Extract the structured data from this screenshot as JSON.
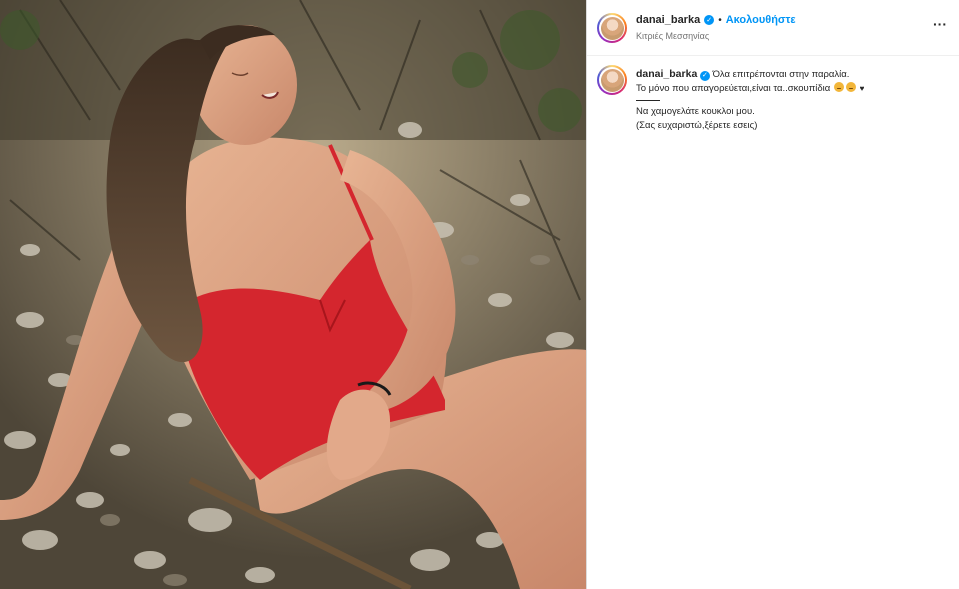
{
  "post": {
    "username": "danai_barka",
    "follow_label": "Ακολουθήστε",
    "separator": "•",
    "location": "Κιτριές Μεσσηνίας",
    "more_label": "···"
  },
  "caption": {
    "username": "danai_barka",
    "line1": "Όλα επιτρέπονται στην παραλία.",
    "line2": "Το μόνο που απαγορεύεται,είναι τα..σκουπίδια",
    "line2_heart": "♥",
    "line3": "Να χαμογελάτε κουκλοι μου.",
    "line4": "(Σας ευχαριστώ,ξέρετε εσεις)"
  },
  "icons": {
    "verified": "verified-badge-icon",
    "more": "more-options-icon",
    "emoji": "emoji-icon"
  },
  "colors": {
    "accent": "#0095f6",
    "text": "#262626",
    "muted": "#737373",
    "swimsuit": "#d4262e"
  }
}
